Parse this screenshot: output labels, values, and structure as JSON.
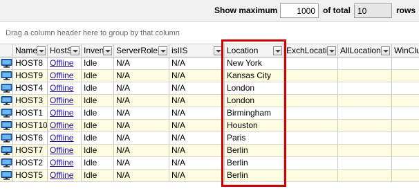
{
  "toolbar": {
    "show_max_label": "Show maximum",
    "show_max_value": "1000",
    "of_total_label": "of total",
    "total_value": "10",
    "rows_label": "rows"
  },
  "group_panel": {
    "hint": "Drag a column header here to group by that column"
  },
  "columns": [
    {
      "key": "name",
      "label": "Name"
    },
    {
      "key": "hosts",
      "label": "HostS"
    },
    {
      "key": "inven",
      "label": "Inven"
    },
    {
      "key": "serverrole",
      "label": "ServerRole"
    },
    {
      "key": "isiis",
      "label": "isIIS"
    },
    {
      "key": "location",
      "label": "Location"
    },
    {
      "key": "exchlocation",
      "label": "ExchLocatio"
    },
    {
      "key": "alllocation",
      "label": "AllLocation"
    },
    {
      "key": "winclu",
      "label": "WinClu"
    }
  ],
  "rows": [
    {
      "name": "HOST8",
      "hosts": "Offline",
      "inven": "Idle",
      "serverrole": "N/A",
      "isiis": "N/A",
      "location": "New York"
    },
    {
      "name": "HOST9",
      "hosts": "Offline",
      "inven": "Idle",
      "serverrole": "N/A",
      "isiis": "N/A",
      "location": "Kansas City"
    },
    {
      "name": "HOST4",
      "hosts": "Offline",
      "inven": "Idle",
      "serverrole": "N/A",
      "isiis": "N/A",
      "location": "London"
    },
    {
      "name": "HOST3",
      "hosts": "Offline",
      "inven": "Idle",
      "serverrole": "N/A",
      "isiis": "N/A",
      "location": "London"
    },
    {
      "name": "HOST1",
      "hosts": "Offline",
      "inven": "Idle",
      "serverrole": "N/A",
      "isiis": "N/A",
      "location": "Birmingham"
    },
    {
      "name": "HOST10",
      "hosts": "Offline",
      "inven": "Idle",
      "serverrole": "N/A",
      "isiis": "N/A",
      "location": "Houston"
    },
    {
      "name": "HOST6",
      "hosts": "Offline",
      "inven": "Idle",
      "serverrole": "N/A",
      "isiis": "N/A",
      "location": "Paris"
    },
    {
      "name": "HOST7",
      "hosts": "Offline",
      "inven": "Idle",
      "serverrole": "N/A",
      "isiis": "N/A",
      "location": "Berlin"
    },
    {
      "name": "HOST2",
      "hosts": "Offline",
      "inven": "Idle",
      "serverrole": "N/A",
      "isiis": "N/A",
      "location": "Berlin"
    },
    {
      "name": "HOST5",
      "hosts": "Offline",
      "inven": "Idle",
      "serverrole": "N/A",
      "isiis": "N/A",
      "location": "Berlin"
    }
  ],
  "row_icon": "computer-icon",
  "colors": {
    "link": "#1a0dab",
    "highlight": "#d10000",
    "alt_row": "#fdfbe0"
  }
}
